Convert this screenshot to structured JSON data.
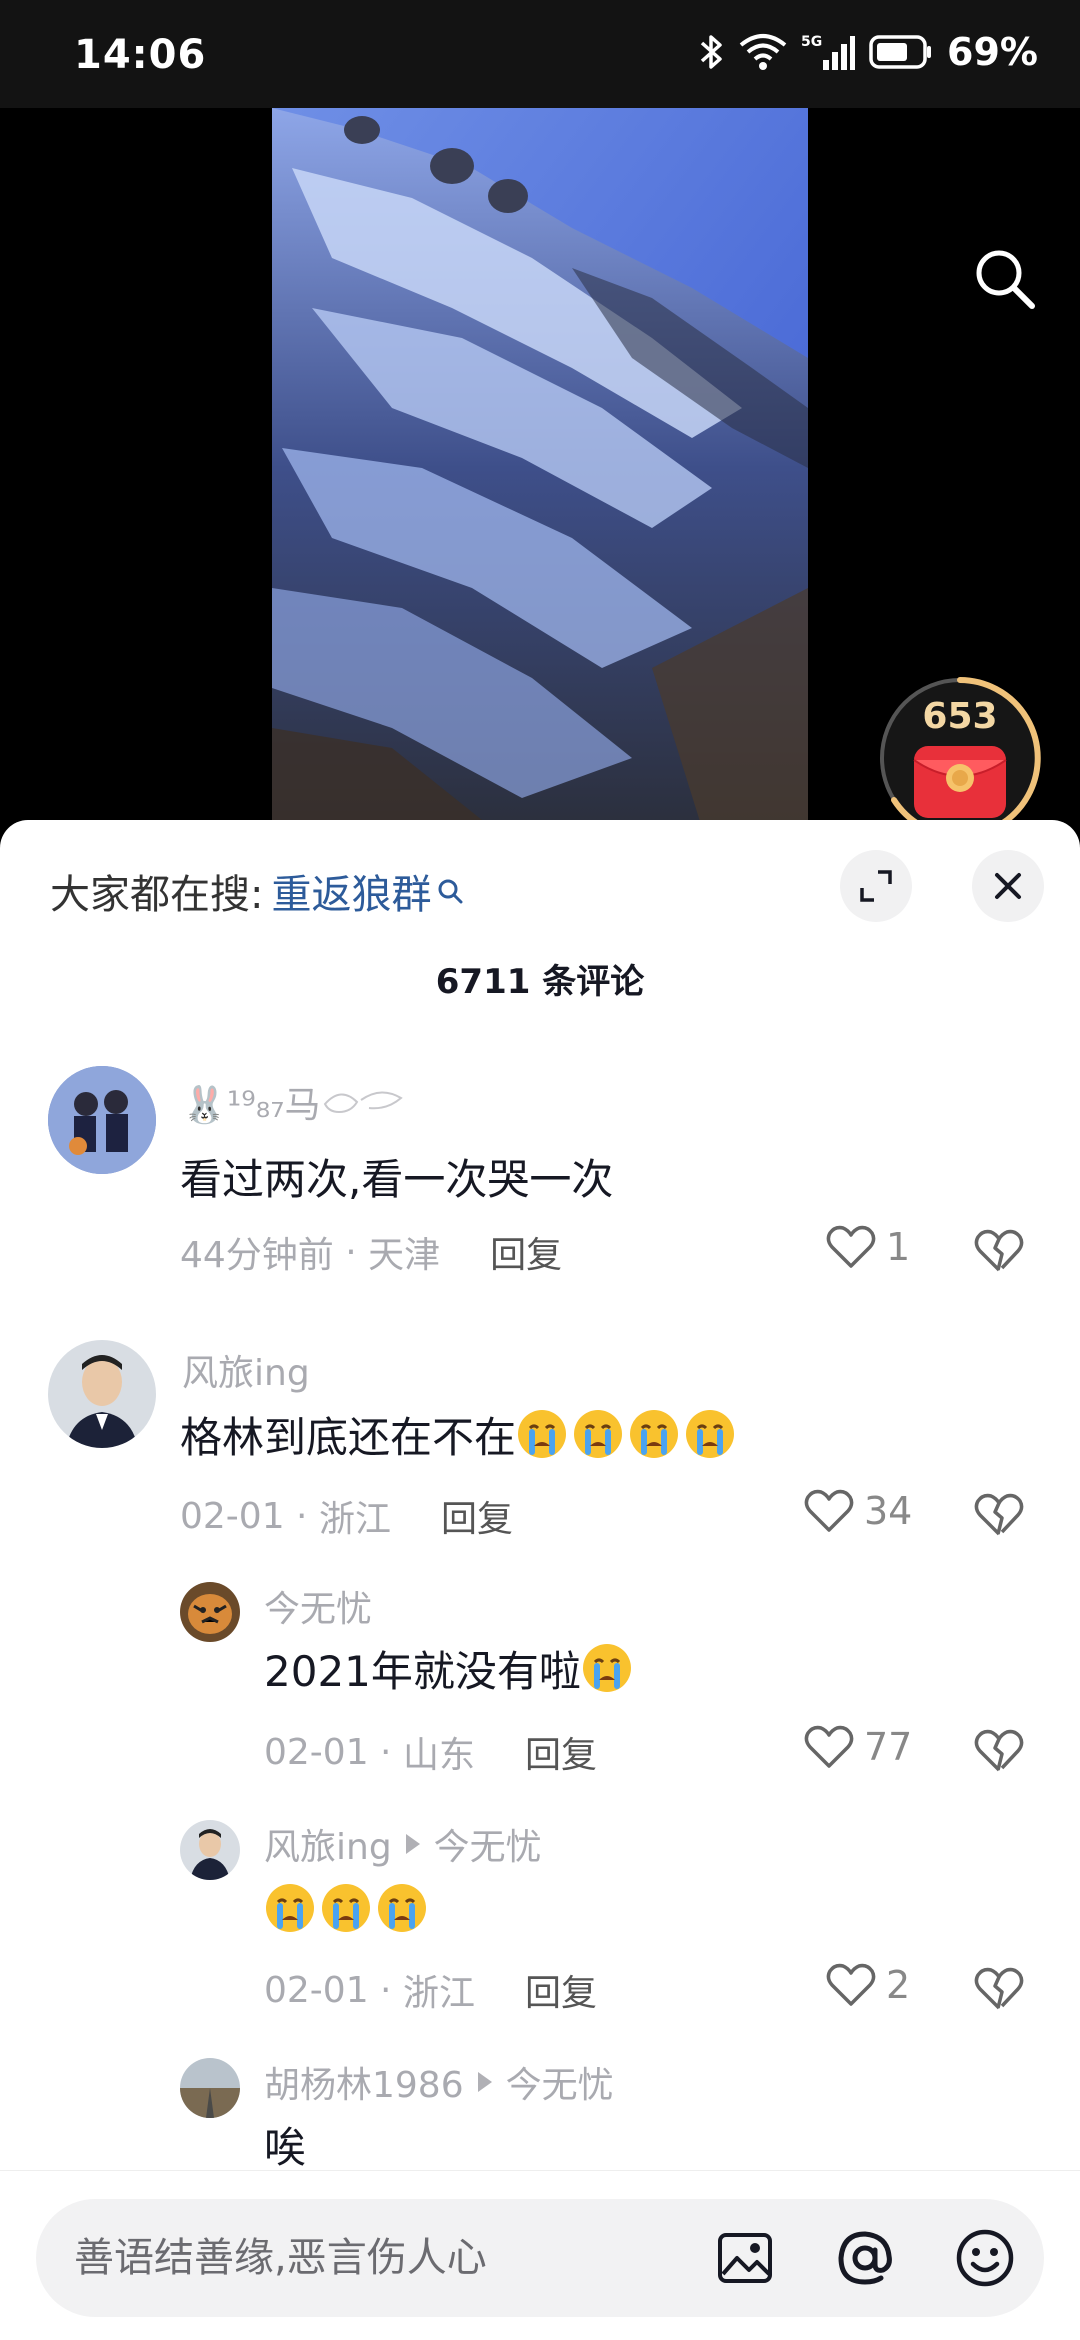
{
  "status_bar": {
    "time": "14:06",
    "battery": "69%",
    "network": "5G"
  },
  "video": {
    "redpack_count": "653"
  },
  "sheet": {
    "hot_search_label": "大家都在搜:",
    "hot_search_keyword": "重返狼群",
    "comment_count_title": "6711 条评论"
  },
  "comments": [
    {
      "user": "🐰¹⁹₈₇马",
      "text": "看过两次,看一次哭一次",
      "time": "44分钟前",
      "location": "天津",
      "reply_label": "回复",
      "likes": "1"
    },
    {
      "user": "风旅ing",
      "text": "格林到底还在不在",
      "time": "02-01",
      "location": "浙江",
      "reply_label": "回复",
      "likes": "34"
    },
    {
      "user": "今无忧",
      "text": "2021年就没有啦",
      "time": "02-01",
      "location": "山东",
      "reply_label": "回复",
      "likes": "77"
    },
    {
      "user": "风旅ing",
      "reply_to": "今无忧",
      "text": "",
      "time": "02-01",
      "location": "浙江",
      "reply_label": "回复",
      "likes": "2"
    },
    {
      "user": "胡杨林1986",
      "reply_to": "今无忧",
      "text": "唉"
    }
  ],
  "input": {
    "placeholder": "善语结善缘,恶言伤人心"
  },
  "colors": {
    "keyword": "#2d5b9a",
    "meta": "#a9aab0",
    "sheet_bg": "#ffffff"
  }
}
